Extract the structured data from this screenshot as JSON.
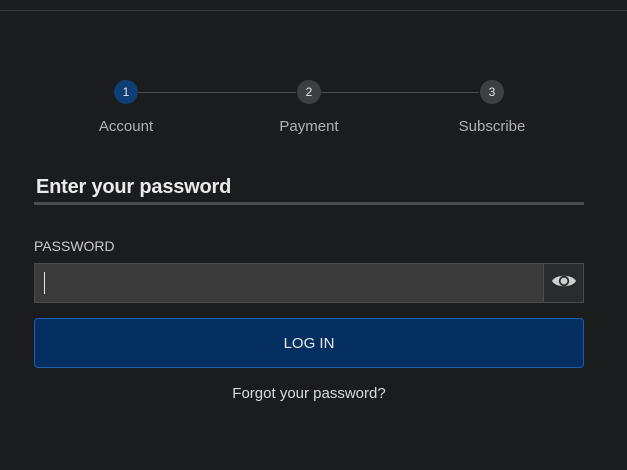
{
  "stepper": {
    "steps": [
      {
        "number": "1",
        "label": "Account",
        "state": "active"
      },
      {
        "number": "2",
        "label": "Payment",
        "state": "inactive"
      },
      {
        "number": "3",
        "label": "Subscribe",
        "state": "inactive"
      }
    ]
  },
  "form": {
    "heading": "Enter your password",
    "password_label": "PASSWORD",
    "password_value": "",
    "password_placeholder": "",
    "reveal_icon": "eye-icon",
    "login_label": "LOG IN",
    "forgot_label": "Forgot your password?"
  },
  "colors": {
    "background": "#1b1c1e",
    "active_step": "#0e3e73",
    "primary_button": "#062f61",
    "primary_button_border": "#1d5fa6"
  }
}
